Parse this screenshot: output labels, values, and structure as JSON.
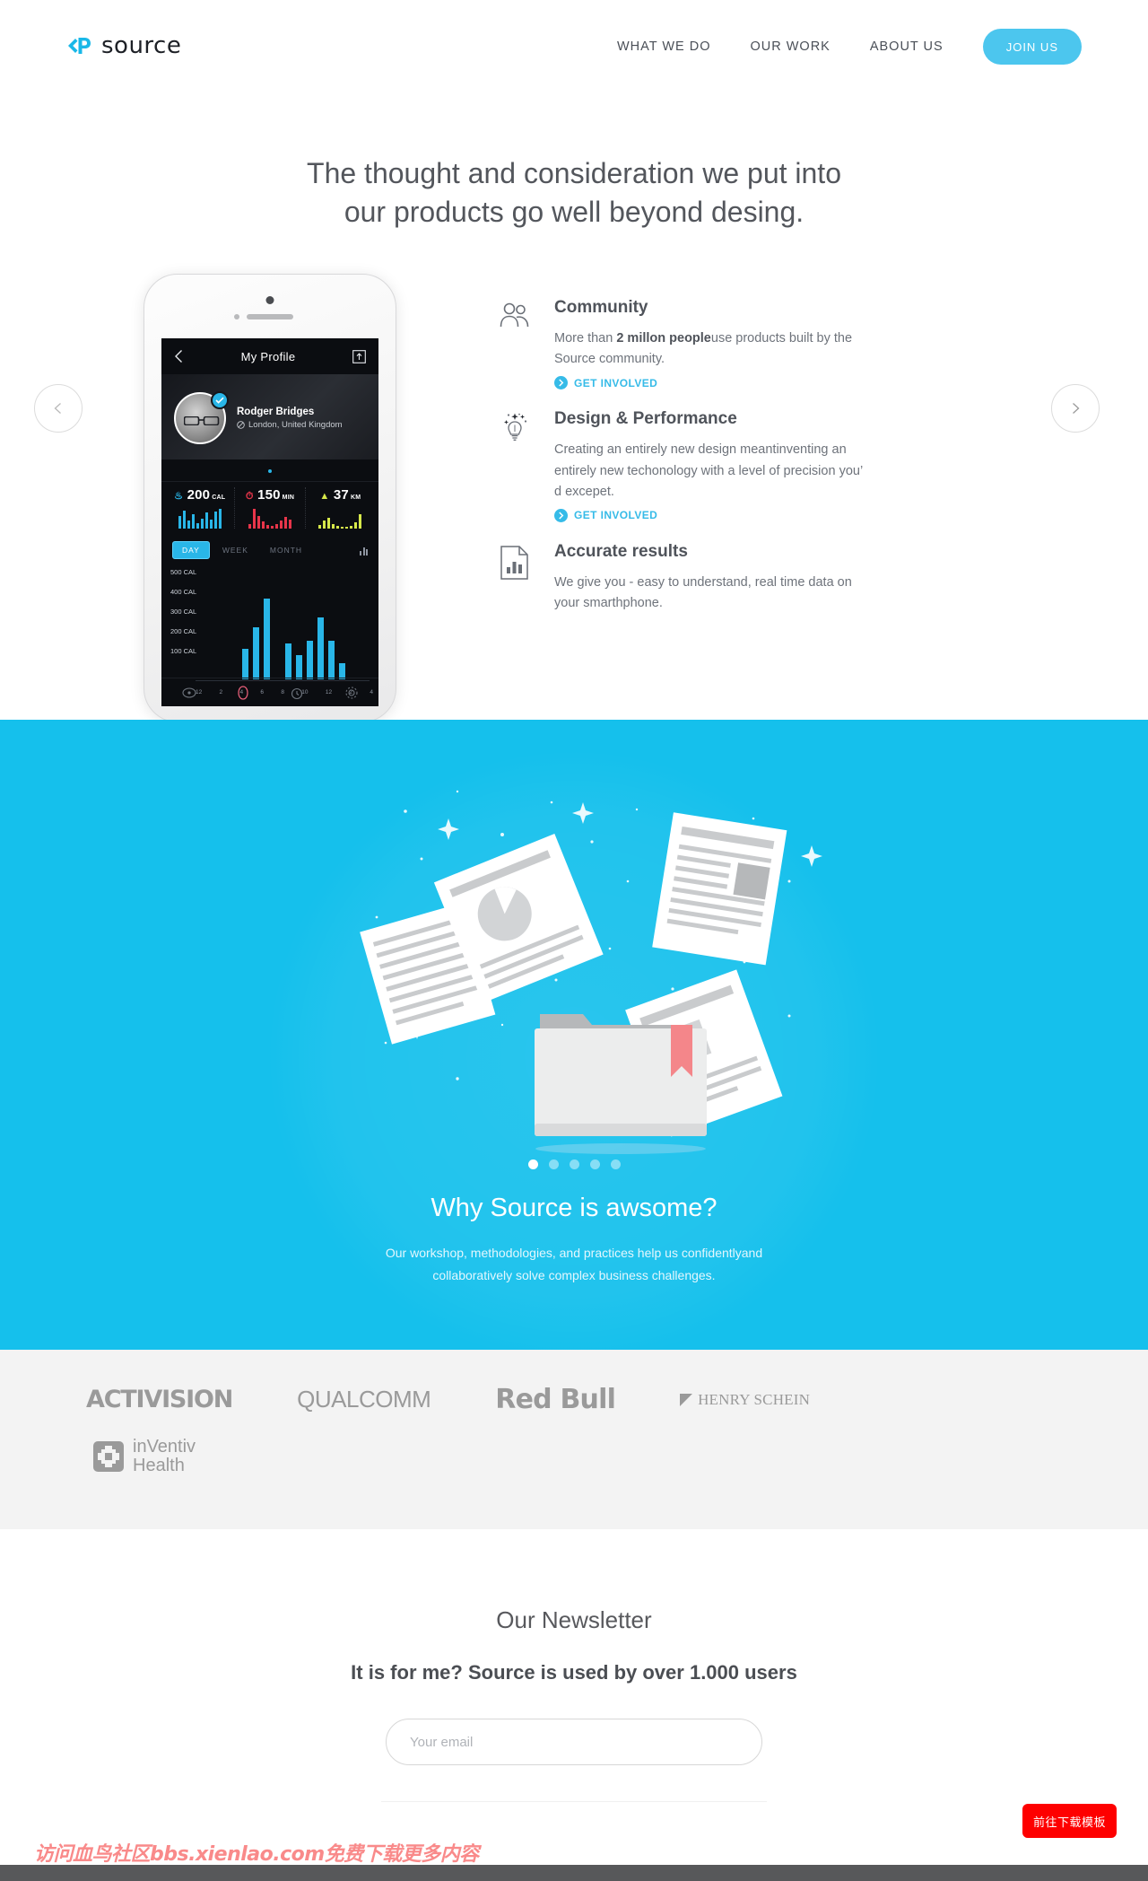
{
  "header": {
    "logo_text": "source",
    "nav": [
      {
        "label": "WHAT WE DO"
      },
      {
        "label": "OUR WORK"
      },
      {
        "label": "ABOUT US"
      }
    ],
    "cta_label": "JOIN US",
    "accent_color": "#4cc6ee"
  },
  "hero": {
    "headline_line1": "The thought and consideration we put into",
    "headline_line2": "our products go well beyond desing.",
    "prev_label": "Previous",
    "next_label": "Next"
  },
  "phone": {
    "screen_title": "My Profile",
    "user_name": "Rodger Bridges",
    "user_location": "London, United Kingdom",
    "stats": [
      {
        "value": "200",
        "unit": "CAL",
        "color": "#29b6e8"
      },
      {
        "value": "150",
        "unit": "MIN",
        "color": "#e8354a"
      },
      {
        "value": "37",
        "unit": "KM",
        "color": "#d6e84a"
      }
    ],
    "range_tabs": [
      {
        "label": "DAY",
        "active": true
      },
      {
        "label": "WEEK",
        "active": false
      },
      {
        "label": "MONTH",
        "active": false
      }
    ],
    "chart_data": {
      "type": "bar",
      "title": "",
      "xlabel": "",
      "ylabel": "CAL",
      "ylim": [
        0,
        500
      ],
      "ytick_labels": [
        "500 CAL",
        "400 CAL",
        "300 CAL",
        "200 CAL",
        "100 CAL"
      ],
      "ytick_values": [
        500,
        400,
        300,
        200,
        100
      ],
      "categories": [
        "12",
        "2",
        "4",
        "6",
        "8",
        "10",
        "12",
        "2",
        "4"
      ],
      "x": [
        "12",
        "1",
        "2",
        "3",
        "4",
        "5",
        "6",
        "7",
        "8",
        "9",
        "10",
        "11",
        "12",
        "1",
        "2",
        "3",
        "4"
      ],
      "values": [
        0,
        0,
        0,
        0,
        150,
        260,
        400,
        0,
        180,
        120,
        190,
        310,
        190,
        80,
        0,
        0,
        0
      ],
      "bar_color": "#29b6e8",
      "grid": false
    },
    "sparklines": [
      {
        "name": "calories",
        "color": "#29b6e8",
        "values": [
          14,
          20,
          9,
          16,
          6,
          11,
          18,
          10,
          19,
          22
        ]
      },
      {
        "name": "minutes",
        "color": "#e8354a",
        "values": [
          5,
          22,
          14,
          8,
          4,
          3,
          5,
          9,
          13,
          10
        ]
      },
      {
        "name": "distance",
        "color": "#d6e84a",
        "values": [
          4,
          9,
          12,
          5,
          3,
          2,
          2,
          3,
          7,
          16
        ]
      }
    ]
  },
  "features": [
    {
      "icon": "community-icon",
      "title": "Community",
      "text_pre": "More than ",
      "text_bold": "2 millon people",
      "text_post": "use products built by the Source community.",
      "link_label": "GET INVOLVED"
    },
    {
      "icon": "lightbulb-icon",
      "title": "Design & Performance",
      "text_pre": "",
      "text_bold": "",
      "text_post": "Creating an entirely new design meantinventing an entirely new techonology with a level of precision you’ d excepet.",
      "link_label": "GET INVOLVED"
    },
    {
      "icon": "document-chart-icon",
      "title": "Accurate results",
      "text_pre": "",
      "text_bold": "",
      "text_post": "We give you - easy to understand, real time data on your smarthphone.",
      "link_label": ""
    }
  ],
  "blue_section": {
    "background_color": "#15c0ec",
    "title": "Why Source is awsome?",
    "subtitle_line1": "Our workshop, methodologies, and practices help us confidentlyand",
    "subtitle_line2": "collaboratively solve complex business challenges.",
    "dots_total": 5,
    "dots_active_index": 0
  },
  "logos": {
    "background_color": "#f3f3f3",
    "items": [
      {
        "name": "activision-logo",
        "label": "ACTIVISION"
      },
      {
        "name": "qualcomm-logo",
        "label": "QUALCOMM"
      },
      {
        "name": "redbull-logo",
        "label": "Red Bull"
      },
      {
        "name": "henry-schein-logo",
        "label": "HENRY SCHEIN"
      },
      {
        "name": "inventiv-health-logo",
        "label_line1": "inVentiv",
        "label_line2": "Health"
      }
    ]
  },
  "newsletter": {
    "heading": "Our Newsletter",
    "subheading": "It is for me? Source is used by over 1.000 users",
    "email_placeholder": "Your email",
    "email_value": ""
  },
  "overlay": {
    "download_button_label": "前往下载模板",
    "download_button_color": "#fe0000",
    "watermark_text": "访问血鸟社区bbs.xienlao.com免费下载更多内容",
    "watermark_color": "#f98a8a"
  }
}
